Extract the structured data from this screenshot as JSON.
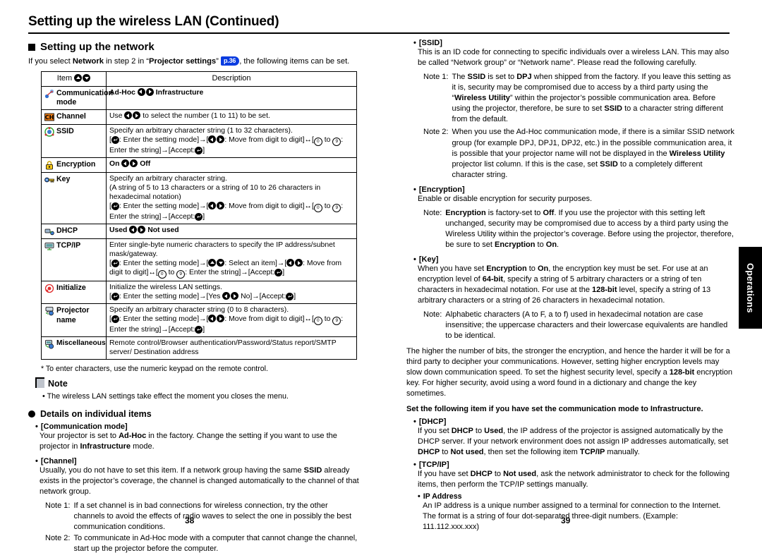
{
  "document": {
    "title": "Setting up the wireless LAN (Continued)",
    "side_tab": "Operations",
    "page_left": "38",
    "page_right": "39"
  },
  "left": {
    "section_heading": "Setting up the network",
    "intro_a": "If you select ",
    "intro_b": "Network",
    "intro_c": " in step 2 in “",
    "intro_d": "Projector settings",
    "intro_e": "” ",
    "page_ref": "p.36",
    "intro_f": ", the following items can be set.",
    "table": {
      "header_item": "Item",
      "header_desc": "Description",
      "rows": [
        {
          "icon": "communication-mode-icon",
          "item": "Communication mode",
          "desc_lines": [
            "Ad-Hoc ◀ ▶ Infrastructure"
          ]
        },
        {
          "icon": "channel-icon",
          "item": "Channel",
          "desc_lines": [
            "Use ◀ ▶ to select the number (1 to 11) to be set."
          ]
        },
        {
          "icon": "ssid-icon",
          "item": "SSID",
          "desc_lines": [
            "Specify an arbitrary character string (1 to 32 characters).",
            "[↵: Enter the setting mode]→[◀ ▶: Move from digit to digit]↔[⓪ to ⑨: Enter the string]→[Accept: ↵]"
          ]
        },
        {
          "icon": "encryption-lock-icon",
          "item": "Encryption",
          "desc_lines": [
            "On ◀ ▶ Off"
          ]
        },
        {
          "icon": "key-icon",
          "item": "Key",
          "desc_lines": [
            "Specify an arbitrary character string.",
            "(A string of 5 to 13 characters or a string of 10 to 26 characters in hexadecimal notation)",
            "[↵: Enter the setting mode]→[◀ ▶: Move from digit to digit]↔[⓪ to ⑨: Enter the string]→[Accept: ↵]"
          ]
        },
        {
          "icon": "dhcp-icon",
          "item": "DHCP",
          "desc_lines": [
            "Used ◀ ▶ Not used"
          ]
        },
        {
          "icon": "tcpip-icon",
          "item": "TCP/IP",
          "desc_lines": [
            "Enter single-byte numeric characters to specify the IP address/subnet mask/gateway.",
            "[↵: Enter the setting mode]→[▲ ▼: Select an item]→[◀ ▶: Move from digit to digit]↔[⓪ to ⑨: Enter the string]→[Accept: ↵]"
          ]
        },
        {
          "icon": "initialize-icon",
          "item": "Initialize",
          "desc_lines": [
            "Initialize the wireless LAN settings.",
            "[↵: Enter the setting mode]→[Yes ◀ ▶ No]→[Accept: ↵]"
          ]
        },
        {
          "icon": "projector-name-icon",
          "item": "Projector name",
          "desc_lines": [
            "Specify an arbitrary character string (0 to 8 characters).",
            "[↵: Enter the setting mode]→[◀ ▶: Move from digit to digit]↔[⓪ to ⑨: Enter the string]→[Accept: ↵]"
          ]
        },
        {
          "icon": "miscellaneous-icon",
          "item": "Miscellaneous",
          "desc_lines": [
            "Remote control/Browser authentication/Password/Status report/SMTP server/ Destination address"
          ]
        }
      ]
    },
    "footnote": "* To enter characters, use the numeric keypad on the remote control.",
    "note_heading": "Note",
    "note_bullet": "• The wireless LAN settings take effect the moment you closes the menu.",
    "details_heading": "Details on individual items",
    "comm_mode": {
      "header": "[Communication mode]",
      "body_a": "Your projector is set to ",
      "body_b": "Ad-Hoc",
      "body_c": " in the factory. Change the setting if you want to use the projector in ",
      "body_d": "Infrastructure",
      "body_e": " mode."
    },
    "channel": {
      "header": "[Channel]",
      "body_a": "Usually, you do not have to set this item. If a network group having the same ",
      "body_b": "SSID",
      "body_c": " already exists in the projector’s coverage, the channel is changed automatically to the channel of that network group.",
      "note1_label": "Note 1:",
      "note1_text": "If a set channel is in bad connections for wireless connection, try the other channels to avoid the effects of radio waves to select the one in possibly the best communication conditions.",
      "note2_label": "Note 2:",
      "note2_text": "To communicate in Ad-Hoc mode with a computer that cannot change the channel, start up the projector before the computer."
    }
  },
  "right": {
    "ssid": {
      "header": "[SSID]",
      "body": "This is an ID code for connecting to specific individuals over a wireless LAN.  This may also be called “Network group” or “Network name”.  Please read the following carefully.",
      "note1_label": "Note 1:",
      "note1_a": "The ",
      "note1_b": "SSID",
      "note1_c": " is set to ",
      "note1_d": "DPJ",
      "note1_e": " when shipped from the factory. If you leave this setting as it is, security may be compromised due to access by a third party using the “",
      "note1_f": "Wireless Utility",
      "note1_g": "” within the projector’s possible communication area. Before using the projector, therefore, be sure to set ",
      "note1_h": "SSID",
      "note1_i": " to a character string different from the default.",
      "note2_label": "Note 2:",
      "note2_a": "When you use the Ad-Hoc communication mode, if there is a similar SSID network group (for example DPJ, DPJ1, DPJ2, etc.) in the possible communication area, it is possible that your projector name will not be displayed in the ",
      "note2_b": "Wireless Utility",
      "note2_c": " projector list column. If this is the case, set ",
      "note2_d": "SSID",
      "note2_e": " to a completely different character string."
    },
    "encryption": {
      "header": "[Encryption]",
      "body": "Enable or disable encryption for security purposes.",
      "note_label": "Note:",
      "note_a": "Encryption",
      "note_b": " is factory-set to ",
      "note_c": "Off",
      "note_d": ". If you use the projector with this setting left unchanged, security may be compromised due to access by a third party using the Wireless Utility within the projector’s coverage. Before using the projector, therefore, be sure to set ",
      "note_e": "Encryption",
      "note_f": " to ",
      "note_g": "On",
      "note_h": "."
    },
    "key": {
      "header": "[Key]",
      "body_a": "When you have set ",
      "body_b": "Encryption",
      "body_c": " to ",
      "body_d": "On",
      "body_e": ", the encryption key must be set. For use at an encryption level of ",
      "body_f": "64-bit",
      "body_g": ", specify a string of 5 arbitrary characters or a string of ten characters in hexadecimal notation. For use at the ",
      "body_h": "128-bit",
      "body_i": " level, specify a string of 13 arbitrary characters or a string of 26 characters in hexadecimal notation.",
      "note_label": "Note:",
      "note_text": "Alphabetic characters (A to F, a to f) used in hexadecimal notation are case insensitive; the uppercase characters and their lowercase equivalents are handled to be identical.",
      "para_a": "The higher the number of bits, the stronger the encryption, and hence the harder it will be for a third party to decipher your communications. However, setting higher encryption levels may slow down communication speed. To set the highest security level, specify a ",
      "para_b": "128-bit",
      "para_c": " encryption key. For higher security, avoid using a word found in a dictionary and change the key sometimes."
    },
    "infra_lead": "Set the following item if you have set the communication mode to Infrastructure.",
    "dhcp": {
      "header": "[DHCP]",
      "body_a": "If you set ",
      "body_b": "DHCP",
      "body_c": " to ",
      "body_d": "Used",
      "body_e": ", the IP address of the projector is assigned automatically by the DHCP server. If your network environment does not assign IP addresses automatically, set ",
      "body_f": "DHCP",
      "body_g": " to ",
      "body_h": "Not used",
      "body_i": ", then set the following item ",
      "body_j": "TCP/IP",
      "body_k": " manually."
    },
    "tcpip": {
      "header": "[TCP/IP]",
      "body_a": "If you have set ",
      "body_b": "DHCP",
      "body_c": " to ",
      "body_d": "Not used",
      "body_e": ", ask the network administrator to check for the following items, then perform the TCP/IP settings manually.",
      "sub_header": "IP Address",
      "sub_body": "An IP address is a unique number assigned to a terminal for connection to the Internet. The format is a string of four dot-separated three-digit numbers. (Example: 111.112.xxx.xxx)"
    }
  }
}
